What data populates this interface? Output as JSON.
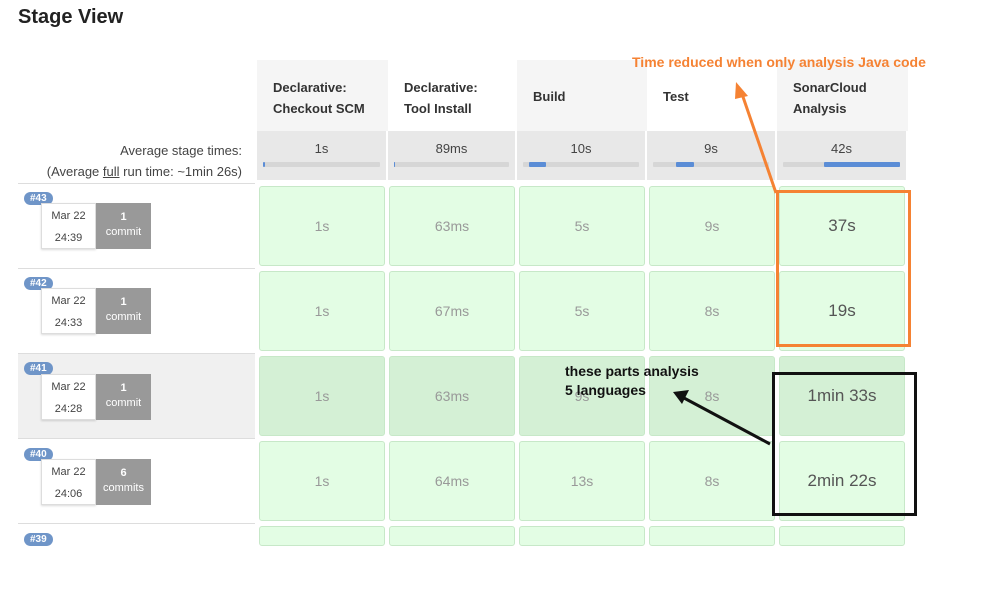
{
  "page": {
    "title": "Stage View"
  },
  "stages": [
    {
      "line1": "Declarative:",
      "line2": "Checkout SCM",
      "avg": "1s",
      "fill_start": 0.0,
      "fill_end": 0.02
    },
    {
      "line1": "Declarative:",
      "line2": "Tool Install",
      "avg": "89ms",
      "fill_start": 0.0,
      "fill_end": 0.01
    },
    {
      "line1": "Build",
      "line2": "",
      "avg": "10s",
      "fill_start": 0.05,
      "fill_end": 0.2
    },
    {
      "line1": "Test",
      "line2": "",
      "avg": "9s",
      "fill_start": 0.2,
      "fill_end": 0.35
    },
    {
      "line1": "SonarCloud",
      "line2": "Analysis",
      "avg": "42s",
      "fill_start": 0.35,
      "fill_end": 1.0
    }
  ],
  "average": {
    "label": "Average stage times:",
    "full_prefix": "(Average ",
    "full_word": "full",
    "full_suffix": " run time: ~1min 26s)"
  },
  "runs": [
    {
      "badge": "#43",
      "date": "Mar 22",
      "time": "24:39",
      "commit_count": "1",
      "commit_word": "commit",
      "stage_times": [
        "1s",
        "63ms",
        "5s",
        "9s",
        "37s"
      ]
    },
    {
      "badge": "#42",
      "date": "Mar 22",
      "time": "24:33",
      "commit_count": "1",
      "commit_word": "commit",
      "stage_times": [
        "1s",
        "67ms",
        "5s",
        "8s",
        "19s"
      ]
    },
    {
      "badge": "#41",
      "date": "Mar 22",
      "time": "24:28",
      "commit_count": "1",
      "commit_word": "commit",
      "stage_times": [
        "1s",
        "63ms",
        "9s",
        "8s",
        "1min 33s"
      ]
    },
    {
      "badge": "#40",
      "date": "Mar 22",
      "time": "24:06",
      "commit_count": "6",
      "commit_word": "commits",
      "stage_times": [
        "1s",
        "64ms",
        "13s",
        "8s",
        "2min 22s"
      ]
    },
    {
      "badge": "#39"
    }
  ],
  "annotations": {
    "orange_note": "Time reduced when only analysis Java code",
    "black_note_line1": "these parts analysis",
    "black_note_line2": "5 languages",
    "orange_color": "#f58233",
    "black_color": "#111111"
  }
}
